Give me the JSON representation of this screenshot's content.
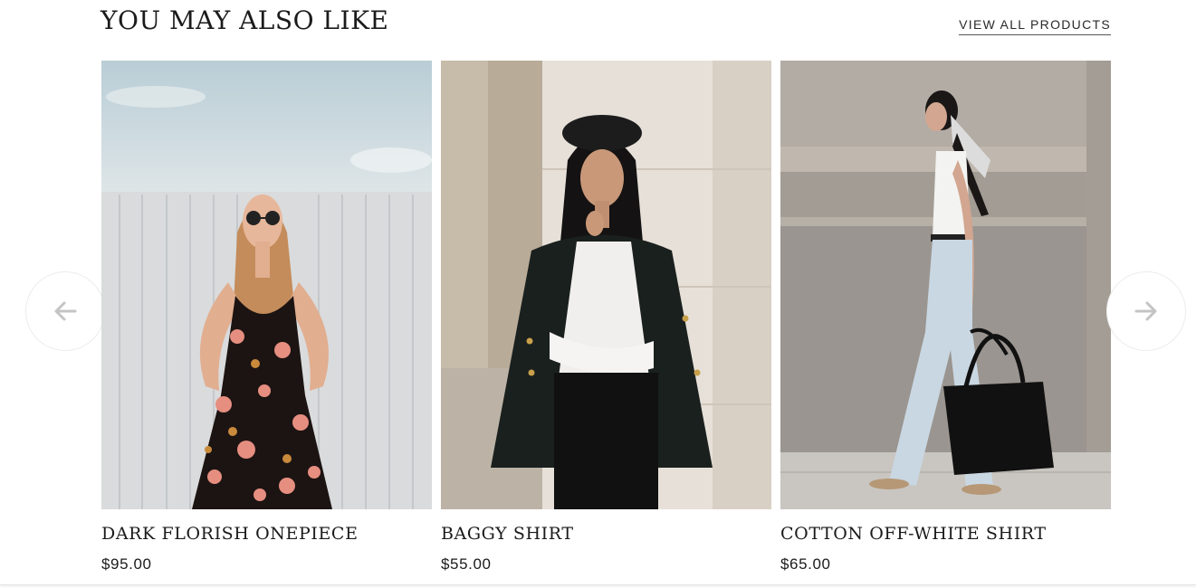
{
  "section": {
    "title": "YOU MAY ALSO LIKE",
    "view_all_label": "VIEW ALL PRODUCTS"
  },
  "carousel": {
    "prev_icon": "arrow-left-icon",
    "next_icon": "arrow-right-icon",
    "arrow_color": "#c4c4c4"
  },
  "products": [
    {
      "name": "DARK FLORISH ONEPIECE",
      "price": "$95.00",
      "image": "woman-in-floral-dress-photo"
    },
    {
      "name": "BAGGY SHIRT",
      "price": "$55.00",
      "image": "woman-in-beret-and-black-blazer-photo"
    },
    {
      "name": "COTTON OFF-WHITE SHIRT",
      "price": "$65.00",
      "image": "woman-walking-with-tote-bag-photo"
    }
  ]
}
